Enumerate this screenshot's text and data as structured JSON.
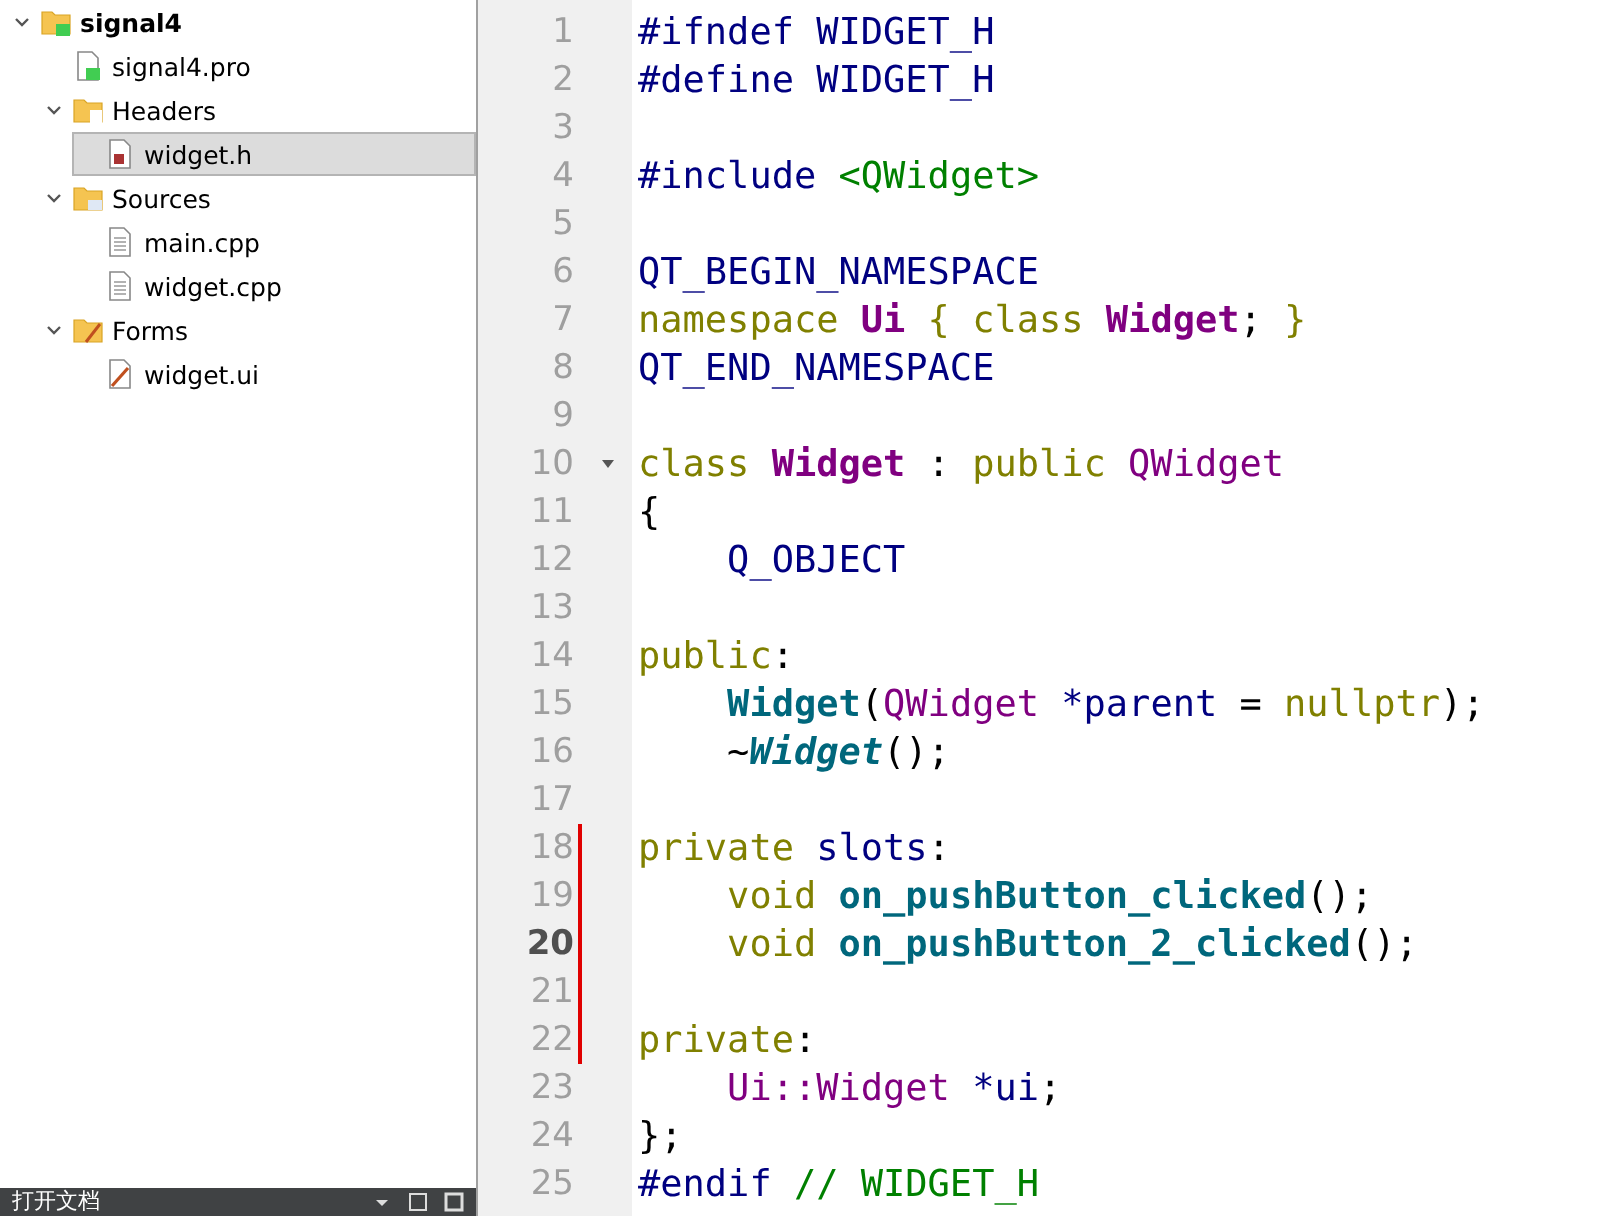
{
  "project_tree": [
    {
      "label": "signal4",
      "kind": "project",
      "expanded": true,
      "selected": false,
      "children": [
        {
          "label": "signal4.pro",
          "kind": "pro-file",
          "selected": false
        },
        {
          "label": "Headers",
          "kind": "header-folder",
          "expanded": true,
          "selected": false,
          "children": [
            {
              "label": "widget.h",
              "kind": "header-file",
              "selected": true
            }
          ]
        },
        {
          "label": "Sources",
          "kind": "source-folder",
          "expanded": true,
          "selected": false,
          "children": [
            {
              "label": "main.cpp",
              "kind": "text-file",
              "selected": false
            },
            {
              "label": "widget.cpp",
              "kind": "text-file",
              "selected": false
            }
          ]
        },
        {
          "label": "Forms",
          "kind": "form-folder",
          "expanded": true,
          "selected": false,
          "children": [
            {
              "label": "widget.ui",
              "kind": "form-file",
              "selected": false
            }
          ]
        }
      ]
    }
  ],
  "bottom_panel": {
    "title": "打开文档"
  },
  "editor": {
    "lines": [
      {
        "number": "1",
        "current": false,
        "changed": false,
        "foldable": false,
        "tokens": [
          {
            "kind": "preproc",
            "text": "#ifndef WIDGET_H"
          }
        ]
      },
      {
        "number": "2",
        "current": false,
        "changed": false,
        "foldable": false,
        "tokens": [
          {
            "kind": "preproc",
            "text": "#define WIDGET_H"
          }
        ]
      },
      {
        "number": "3",
        "current": false,
        "changed": false,
        "foldable": false
      },
      {
        "number": "4",
        "current": false,
        "changed": false,
        "foldable": false,
        "tokens": [
          {
            "kind": "preproc",
            "text": "#include "
          },
          {
            "kind": "string",
            "text": "<QWidget>"
          }
        ]
      },
      {
        "number": "5",
        "current": false,
        "changed": false,
        "foldable": false
      },
      {
        "number": "6",
        "current": false,
        "changed": false,
        "foldable": false,
        "tokens": [
          {
            "kind": "preproc",
            "text": "QT_BEGIN_NAMESPACE"
          }
        ]
      },
      {
        "number": "7",
        "current": false,
        "changed": false,
        "foldable": false,
        "tokens": [
          {
            "kind": "keyword",
            "text": "namespace "
          },
          {
            "kind": "type",
            "text": "Ui"
          },
          {
            "kind": "keyword",
            "text": " { class "
          },
          {
            "kind": "type",
            "text": "Widget"
          },
          {
            "kind": "punct",
            "text": "; "
          },
          {
            "kind": "keyword",
            "text": "}"
          }
        ]
      },
      {
        "number": "8",
        "current": false,
        "changed": false,
        "foldable": false,
        "tokens": [
          {
            "kind": "preproc",
            "text": "QT_END_NAMESPACE"
          }
        ]
      },
      {
        "number": "9",
        "current": false,
        "changed": false,
        "foldable": false
      },
      {
        "number": "10",
        "current": false,
        "changed": false,
        "foldable": true,
        "tokens": [
          {
            "kind": "keyword",
            "text": "class "
          },
          {
            "kind": "type",
            "text": "Widget"
          },
          {
            "kind": "punct",
            "text": " : "
          },
          {
            "kind": "keyword",
            "text": "public "
          },
          {
            "kind": "class",
            "text": "QWidget"
          }
        ]
      },
      {
        "number": "11",
        "current": false,
        "changed": false,
        "foldable": false,
        "tokens": [
          {
            "kind": "punct",
            "text": "{"
          }
        ]
      },
      {
        "number": "12",
        "current": false,
        "changed": false,
        "foldable": false,
        "tokens": [
          {
            "kind": "preproc",
            "text": "    Q_OBJECT"
          }
        ]
      },
      {
        "number": "13",
        "current": false,
        "changed": false,
        "foldable": false
      },
      {
        "number": "14",
        "current": false,
        "changed": false,
        "foldable": false,
        "tokens": [
          {
            "kind": "keyword",
            "text": "public"
          },
          {
            "kind": "punct",
            "text": ":"
          }
        ]
      },
      {
        "number": "15",
        "current": false,
        "changed": false,
        "foldable": false,
        "tokens": [
          {
            "kind": "function",
            "text": "    Widget"
          },
          {
            "kind": "punct",
            "text": "("
          },
          {
            "kind": "class",
            "text": "QWidget"
          },
          {
            "kind": "preproc",
            "text": " *parent "
          },
          {
            "kind": "punct",
            "text": "= "
          },
          {
            "kind": "keyword",
            "text": "nullptr"
          },
          {
            "kind": "punct",
            "text": ");"
          }
        ]
      },
      {
        "number": "16",
        "current": false,
        "changed": false,
        "foldable": false,
        "tokens": [
          {
            "kind": "punct",
            "text": "    ~"
          },
          {
            "kind": "virtual",
            "text": "Widget"
          },
          {
            "kind": "punct",
            "text": "();"
          }
        ]
      },
      {
        "number": "17",
        "current": false,
        "changed": false,
        "foldable": false
      },
      {
        "number": "18",
        "current": false,
        "changed": true,
        "foldable": false,
        "tokens": [
          {
            "kind": "keyword",
            "text": "private "
          },
          {
            "kind": "preproc",
            "text": "slots"
          },
          {
            "kind": "punct",
            "text": ":"
          }
        ]
      },
      {
        "number": "19",
        "current": false,
        "changed": true,
        "foldable": false,
        "tokens": [
          {
            "kind": "keyword",
            "text": "    void "
          },
          {
            "kind": "function",
            "text": "on_pushButton_clicked"
          },
          {
            "kind": "punct",
            "text": "();"
          }
        ]
      },
      {
        "number": "20",
        "current": true,
        "changed": true,
        "foldable": false,
        "tokens": [
          {
            "kind": "keyword",
            "text": "    void "
          },
          {
            "kind": "function",
            "text": "on_pushButton_2_clicked"
          },
          {
            "kind": "punct",
            "text": "();"
          }
        ]
      },
      {
        "number": "21",
        "current": false,
        "changed": true,
        "foldable": false
      },
      {
        "number": "22",
        "current": false,
        "changed": true,
        "foldable": false,
        "tokens": [
          {
            "kind": "keyword",
            "text": "private"
          },
          {
            "kind": "punct",
            "text": ":"
          }
        ]
      },
      {
        "number": "23",
        "current": false,
        "changed": false,
        "foldable": false,
        "tokens": [
          {
            "kind": "class",
            "text": "    Ui::Widget"
          },
          {
            "kind": "preproc",
            "text": " *ui"
          },
          {
            "kind": "punct",
            "text": ";"
          }
        ]
      },
      {
        "number": "24",
        "current": false,
        "changed": false,
        "foldable": false,
        "tokens": [
          {
            "kind": "punct",
            "text": "};"
          }
        ]
      },
      {
        "number": "25",
        "current": false,
        "changed": false,
        "foldable": false,
        "tokens": [
          {
            "kind": "preproc",
            "text": "#endif "
          },
          {
            "kind": "comment",
            "text": "// WIDGET_H"
          }
        ]
      }
    ]
  }
}
